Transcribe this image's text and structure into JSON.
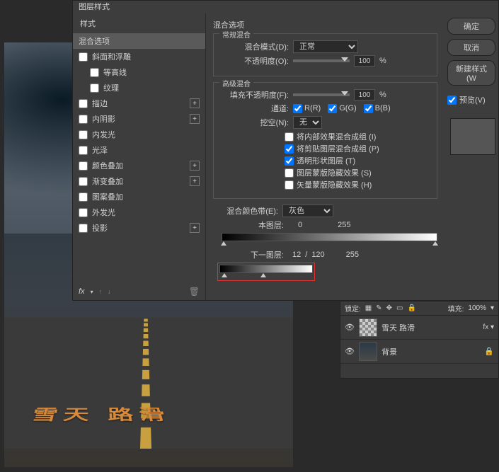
{
  "dialog": {
    "title": "图层样式",
    "styles_header": "样式",
    "blending_options": "混合选项",
    "style_items": [
      {
        "label": "斜面和浮雕",
        "checkbox": true,
        "plus": false
      },
      {
        "label": "等高线",
        "checkbox": true,
        "plus": false,
        "indent": true
      },
      {
        "label": "纹理",
        "checkbox": true,
        "plus": false,
        "indent": true
      },
      {
        "label": "描边",
        "checkbox": true,
        "plus": true
      },
      {
        "label": "内阴影",
        "checkbox": true,
        "plus": true
      },
      {
        "label": "内发光",
        "checkbox": true,
        "plus": false
      },
      {
        "label": "光泽",
        "checkbox": true,
        "plus": false
      },
      {
        "label": "颜色叠加",
        "checkbox": true,
        "plus": true
      },
      {
        "label": "渐变叠加",
        "checkbox": true,
        "plus": true
      },
      {
        "label": "图案叠加",
        "checkbox": true,
        "plus": false
      },
      {
        "label": "外发光",
        "checkbox": true,
        "plus": false
      },
      {
        "label": "投影",
        "checkbox": true,
        "plus": true
      }
    ],
    "fx_label": "fx"
  },
  "opts": {
    "title": "混合选项",
    "general": {
      "group": "常规混合",
      "mode_label": "混合模式(D):",
      "mode_value": "正常",
      "opacity_label": "不透明度(O):",
      "opacity_value": "100",
      "pct": "%"
    },
    "advanced": {
      "group": "高级混合",
      "fill_label": "填充不透明度(F):",
      "fill_value": "100",
      "pct": "%",
      "channels_label": "通道:",
      "ch_r": "R(R)",
      "ch_g": "G(G)",
      "ch_b": "B(B)",
      "knockout_label": "挖空(N):",
      "knockout_value": "无",
      "c1": "将内部效果混合成组 (I)",
      "c2": "将剪贴图层混合成组 (P)",
      "c3": "透明形状图层 (T)",
      "c4": "图层蒙版隐藏效果 (S)",
      "c5": "矢量蒙版隐藏效果 (H)"
    },
    "blendif": {
      "label": "混合颜色带(E):",
      "value": "灰色",
      "this_layer": "本图层:",
      "this_vals": [
        "0",
        "255"
      ],
      "under_layer": "下一图层:",
      "under_vals": [
        "12",
        "/",
        "120",
        "255"
      ]
    }
  },
  "buttons": {
    "ok": "确定",
    "cancel": "取消",
    "new_style": "新建样式(W",
    "preview": "预览(V)"
  },
  "layers": {
    "lock_label": "锁定:",
    "fill_label": "填充:",
    "fill_value": "100%",
    "rows": [
      {
        "name": "雪天     路滑",
        "fx": true
      },
      {
        "name": "背景",
        "locked": true
      }
    ]
  },
  "road_text": "雪天   路滑"
}
